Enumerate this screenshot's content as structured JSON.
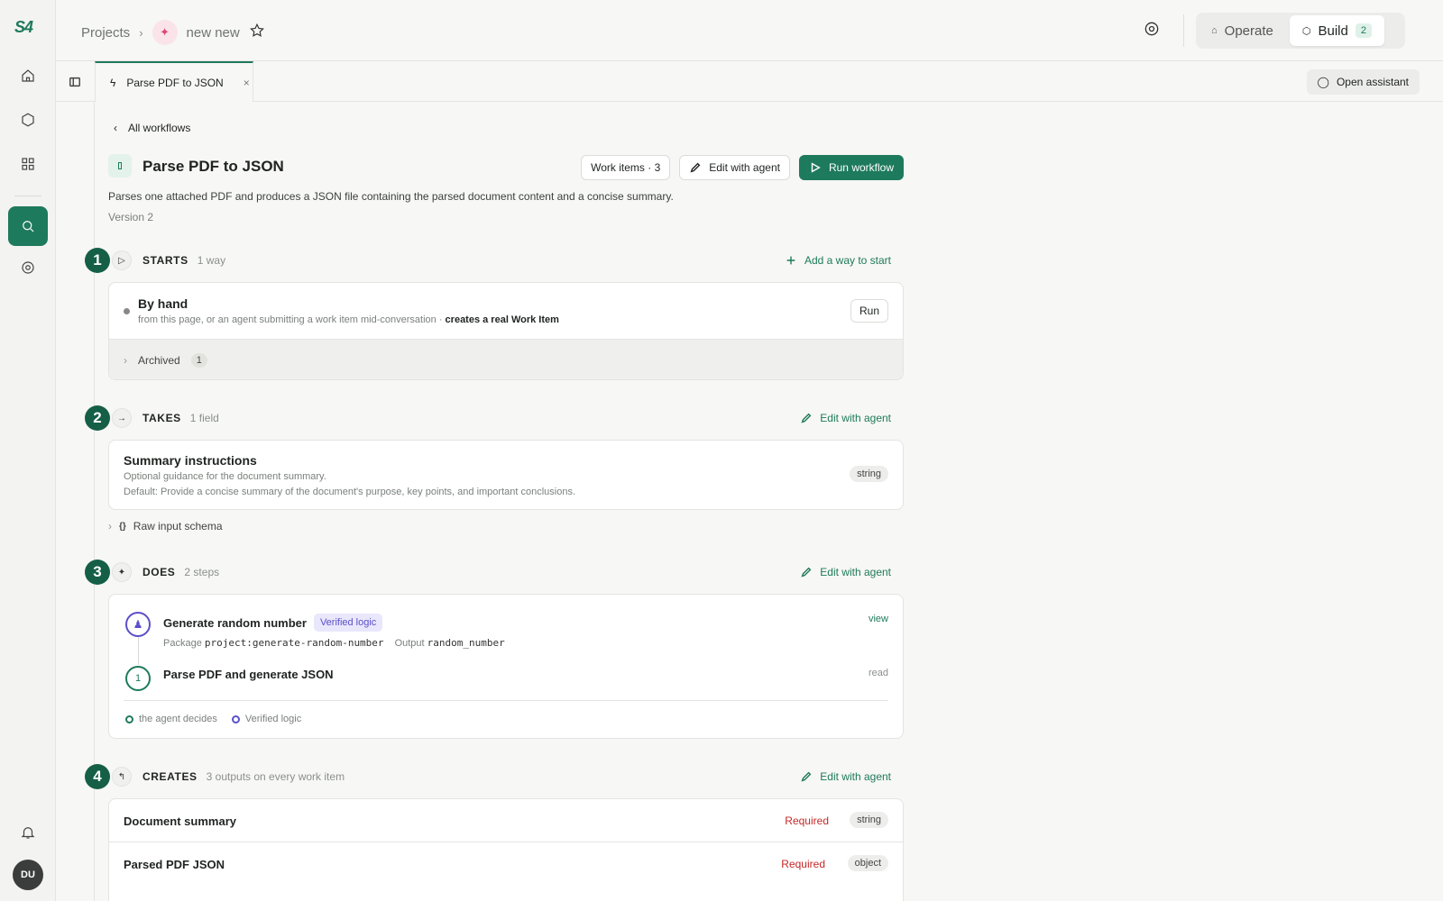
{
  "rail": {
    "logo": "S4",
    "avatar": "DU"
  },
  "breadcrumb": {
    "root": "Projects",
    "project": "new new"
  },
  "modes": {
    "operate": "Operate",
    "build": "Build",
    "build_count": "2"
  },
  "tab": {
    "label": "Parse PDF to JSON",
    "close": "×"
  },
  "assistant": {
    "label": "Open assistant"
  },
  "workflow": {
    "back": "All workflows",
    "title": "Parse PDF to JSON",
    "work_items": "Work items · 3",
    "edit_with_agent": "Edit with agent",
    "run": "Run workflow",
    "description": "Parses one attached PDF and produces a JSON file containing the parsed document content and a concise summary.",
    "version": "Version 2"
  },
  "starts": {
    "number": "1",
    "name": "STARTS",
    "sub": "1 way",
    "action": "Add a way to start",
    "item_title": "By hand",
    "item_desc": "from this page, or an agent submitting a work item mid-conversation · ",
    "item_desc_bold": "creates a real Work Item",
    "run": "Run",
    "archived": "Archived",
    "archived_count": "1"
  },
  "takes": {
    "number": "2",
    "name": "TAKES",
    "sub": "1 field",
    "action": "Edit with agent",
    "field_title": "Summary instructions",
    "field_desc": "Optional guidance for the document summary.",
    "field_default": "Default: Provide a concise summary of the document's purpose, key points, and important conclusions.",
    "field_type": "string",
    "raw_schema": "Raw input schema"
  },
  "does": {
    "number": "3",
    "name": "DOES",
    "sub": "2 steps",
    "action": "Edit with agent",
    "step1_title": "Generate random number",
    "step1_badge": "Verified logic",
    "step1_pkg_label": "Package",
    "step1_pkg": "project:generate-random-number",
    "step1_out_label": "Output",
    "step1_out": "random_number",
    "step1_link": "view",
    "step2_num": "1",
    "step2_title": "Parse PDF and generate JSON",
    "step2_link": "read",
    "legend_agent": "the agent decides",
    "legend_verified": "Verified logic"
  },
  "creates": {
    "number": "4",
    "name": "CREATES",
    "sub": "3 outputs on every work item",
    "action": "Edit with agent",
    "outputs": [
      {
        "name": "Document summary",
        "req": "Required",
        "type": "string"
      },
      {
        "name": "Parsed PDF JSON",
        "req": "Required",
        "type": "object"
      }
    ]
  },
  "colors": {
    "accent": "#1e7a5c",
    "number_badge": "#155f47",
    "verified": "#5b4fc9",
    "required": "#c62828"
  }
}
